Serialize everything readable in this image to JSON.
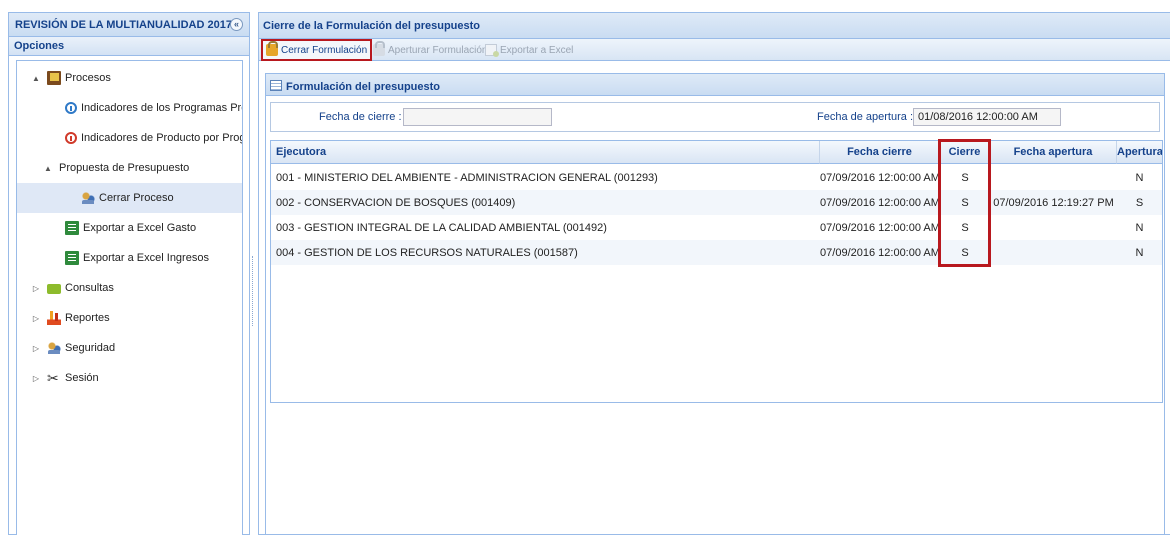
{
  "left_panel": {
    "title": "REVISIÓN DE LA MULTIANUALIDAD 2017",
    "collapse_glyph": "«",
    "options_label": "Opciones",
    "tree": [
      {
        "id": "procesos",
        "label": "Procesos",
        "icon": "book-icon",
        "expander": "▲"
      },
      {
        "id": "indicadores-programas",
        "label": "Indicadores de los Programas Presupu",
        "icon": "info-icon"
      },
      {
        "id": "indicadores-producto",
        "label": "Indicadores de Producto por Programa",
        "icon": "warning-icon"
      },
      {
        "id": "propuesta",
        "label": "Propuesta de Presupuesto",
        "expander": "▲"
      },
      {
        "id": "cerrar-proceso",
        "label": "Cerrar Proceso",
        "icon": "users-icon",
        "selected": true
      },
      {
        "id": "exportar-gasto",
        "label": "Exportar a Excel Gasto",
        "icon": "excel-icon"
      },
      {
        "id": "exportar-ingresos",
        "label": "Exportar a Excel Ingresos",
        "icon": "excel-icon"
      },
      {
        "id": "consultas",
        "label": "Consultas",
        "icon": "folder-icon",
        "expander": "▷"
      },
      {
        "id": "reportes",
        "label": "Reportes",
        "icon": "chart-icon",
        "expander": "▷"
      },
      {
        "id": "seguridad",
        "label": "Seguridad",
        "icon": "users-icon",
        "expander": "▷"
      },
      {
        "id": "sesion",
        "label": "Sesión",
        "icon": "scissors-icon",
        "expander": "▷"
      }
    ]
  },
  "main": {
    "title": "Cierre de la Formulación del presupuesto",
    "toolbar": {
      "cerrar": "Cerrar Formulación",
      "aperturar": "Aperturar Formulación",
      "exportar": "Exportar a Excel"
    },
    "section_title": "Formulación del presupuesto",
    "filters": {
      "fecha_cierre_label": "Fecha de cierre :",
      "fecha_cierre_value": "",
      "fecha_apertura_label": "Fecha de apertura :",
      "fecha_apertura_value": "01/08/2016 12:00:00 AM"
    },
    "grid": {
      "columns": {
        "ejecutora": "Ejecutora",
        "fecha_cierre": "Fecha cierre",
        "cierre": "Cierre",
        "fecha_apertura": "Fecha apertura",
        "apertura": "Apertura"
      },
      "rows": [
        {
          "ejecutora": "001 - MINISTERIO DEL AMBIENTE - ADMINISTRACION GENERAL (001293)",
          "fecha_cierre": "07/09/2016 12:00:00 AM",
          "cierre": "S",
          "fecha_apertura": "",
          "apertura": "N"
        },
        {
          "ejecutora": "002 - CONSERVACION DE BOSQUES (001409)",
          "fecha_cierre": "07/09/2016 12:00:00 AM",
          "cierre": "S",
          "fecha_apertura": "07/09/2016 12:19:27 PM",
          "apertura": "S"
        },
        {
          "ejecutora": "003 - GESTION INTEGRAL DE LA CALIDAD AMBIENTAL (001492)",
          "fecha_cierre": "07/09/2016 12:00:00 AM",
          "cierre": "S",
          "fecha_apertura": "",
          "apertura": "N"
        },
        {
          "ejecutora": "004 - GESTION DE LOS RECURSOS NATURALES (001587)",
          "fecha_cierre": "07/09/2016 12:00:00 AM",
          "cierre": "S",
          "fecha_apertura": "",
          "apertura": "N"
        }
      ]
    }
  },
  "colors": {
    "header_text": "#15428b",
    "border": "#99bbe8",
    "highlight": "#b8181e",
    "selected_row": "#dfe8f6"
  }
}
